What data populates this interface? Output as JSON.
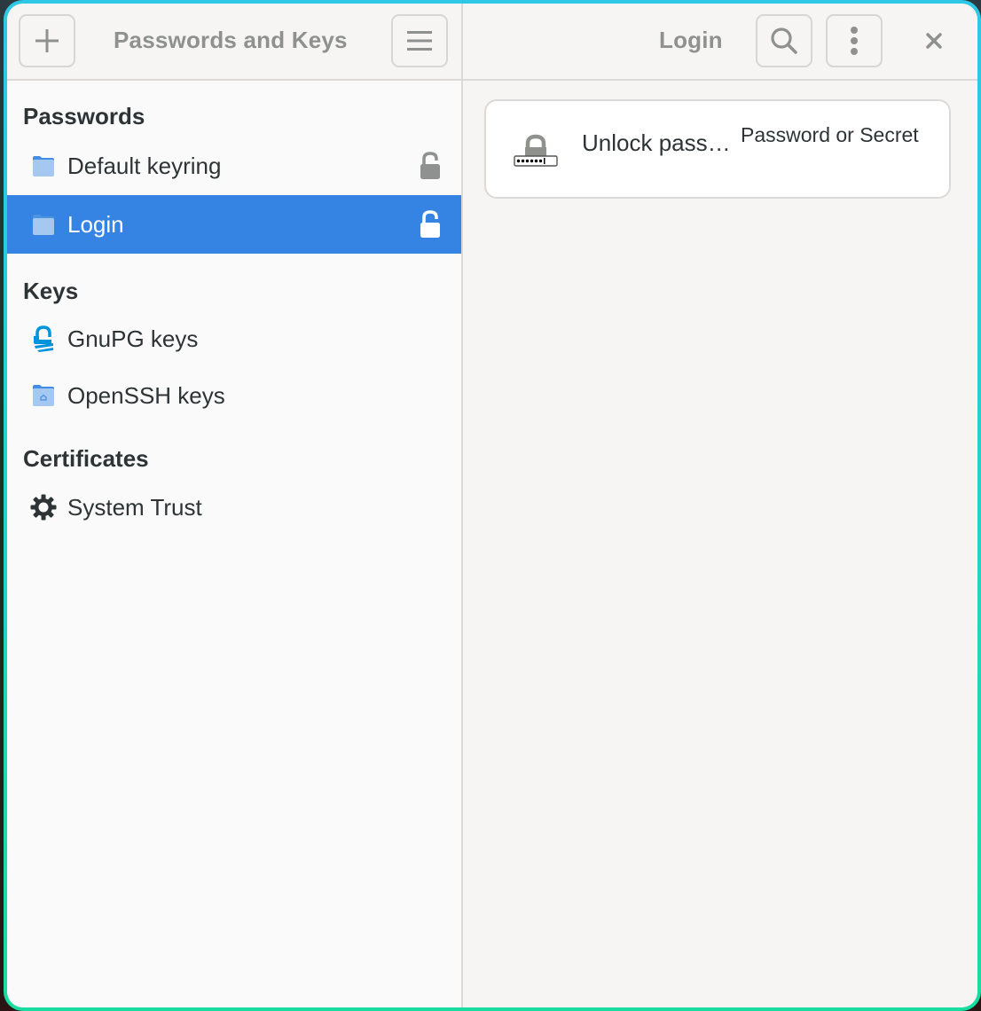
{
  "window": {
    "title": "Passwords and Keys"
  },
  "sidebar_header": {
    "add_button_icon": "plus-icon",
    "title": "Passwords and Keys",
    "menu_button_icon": "hamburger-menu-icon"
  },
  "content_header": {
    "title": "Login",
    "search_button_icon": "search-icon",
    "more_button_icon": "vertical-ellipsis-icon",
    "close_button_icon": "close-icon"
  },
  "sidebar": {
    "sections": [
      {
        "heading": "Passwords",
        "items": [
          {
            "label": "Default keyring",
            "icon": "folder-icon",
            "lock": "unlocked",
            "selected": false
          },
          {
            "label": "Login",
            "icon": "folder-icon",
            "lock": "unlocked",
            "selected": true
          }
        ]
      },
      {
        "heading": "Keys",
        "items": [
          {
            "label": "GnuPG keys",
            "icon": "gnupg-icon",
            "selected": false
          },
          {
            "label": "OpenSSH keys",
            "icon": "folder-home-icon",
            "selected": false
          }
        ]
      },
      {
        "heading": "Certificates",
        "items": [
          {
            "label": "System Trust",
            "icon": "gear-icon",
            "selected": false
          }
        ]
      }
    ]
  },
  "content": {
    "items": [
      {
        "icon": "password-lock-icon",
        "title": "Unlock pass…",
        "type": "Password or Secret"
      }
    ]
  },
  "colors": {
    "accent": "#3584e4",
    "header_text": "#8e9190",
    "body_text": "#2e3436",
    "folder_blue": "#a5c8f0",
    "gnupg_blue": "#0093dd",
    "window_border_top": "#2fc7e6",
    "window_border_bottom": "#19dca0"
  }
}
